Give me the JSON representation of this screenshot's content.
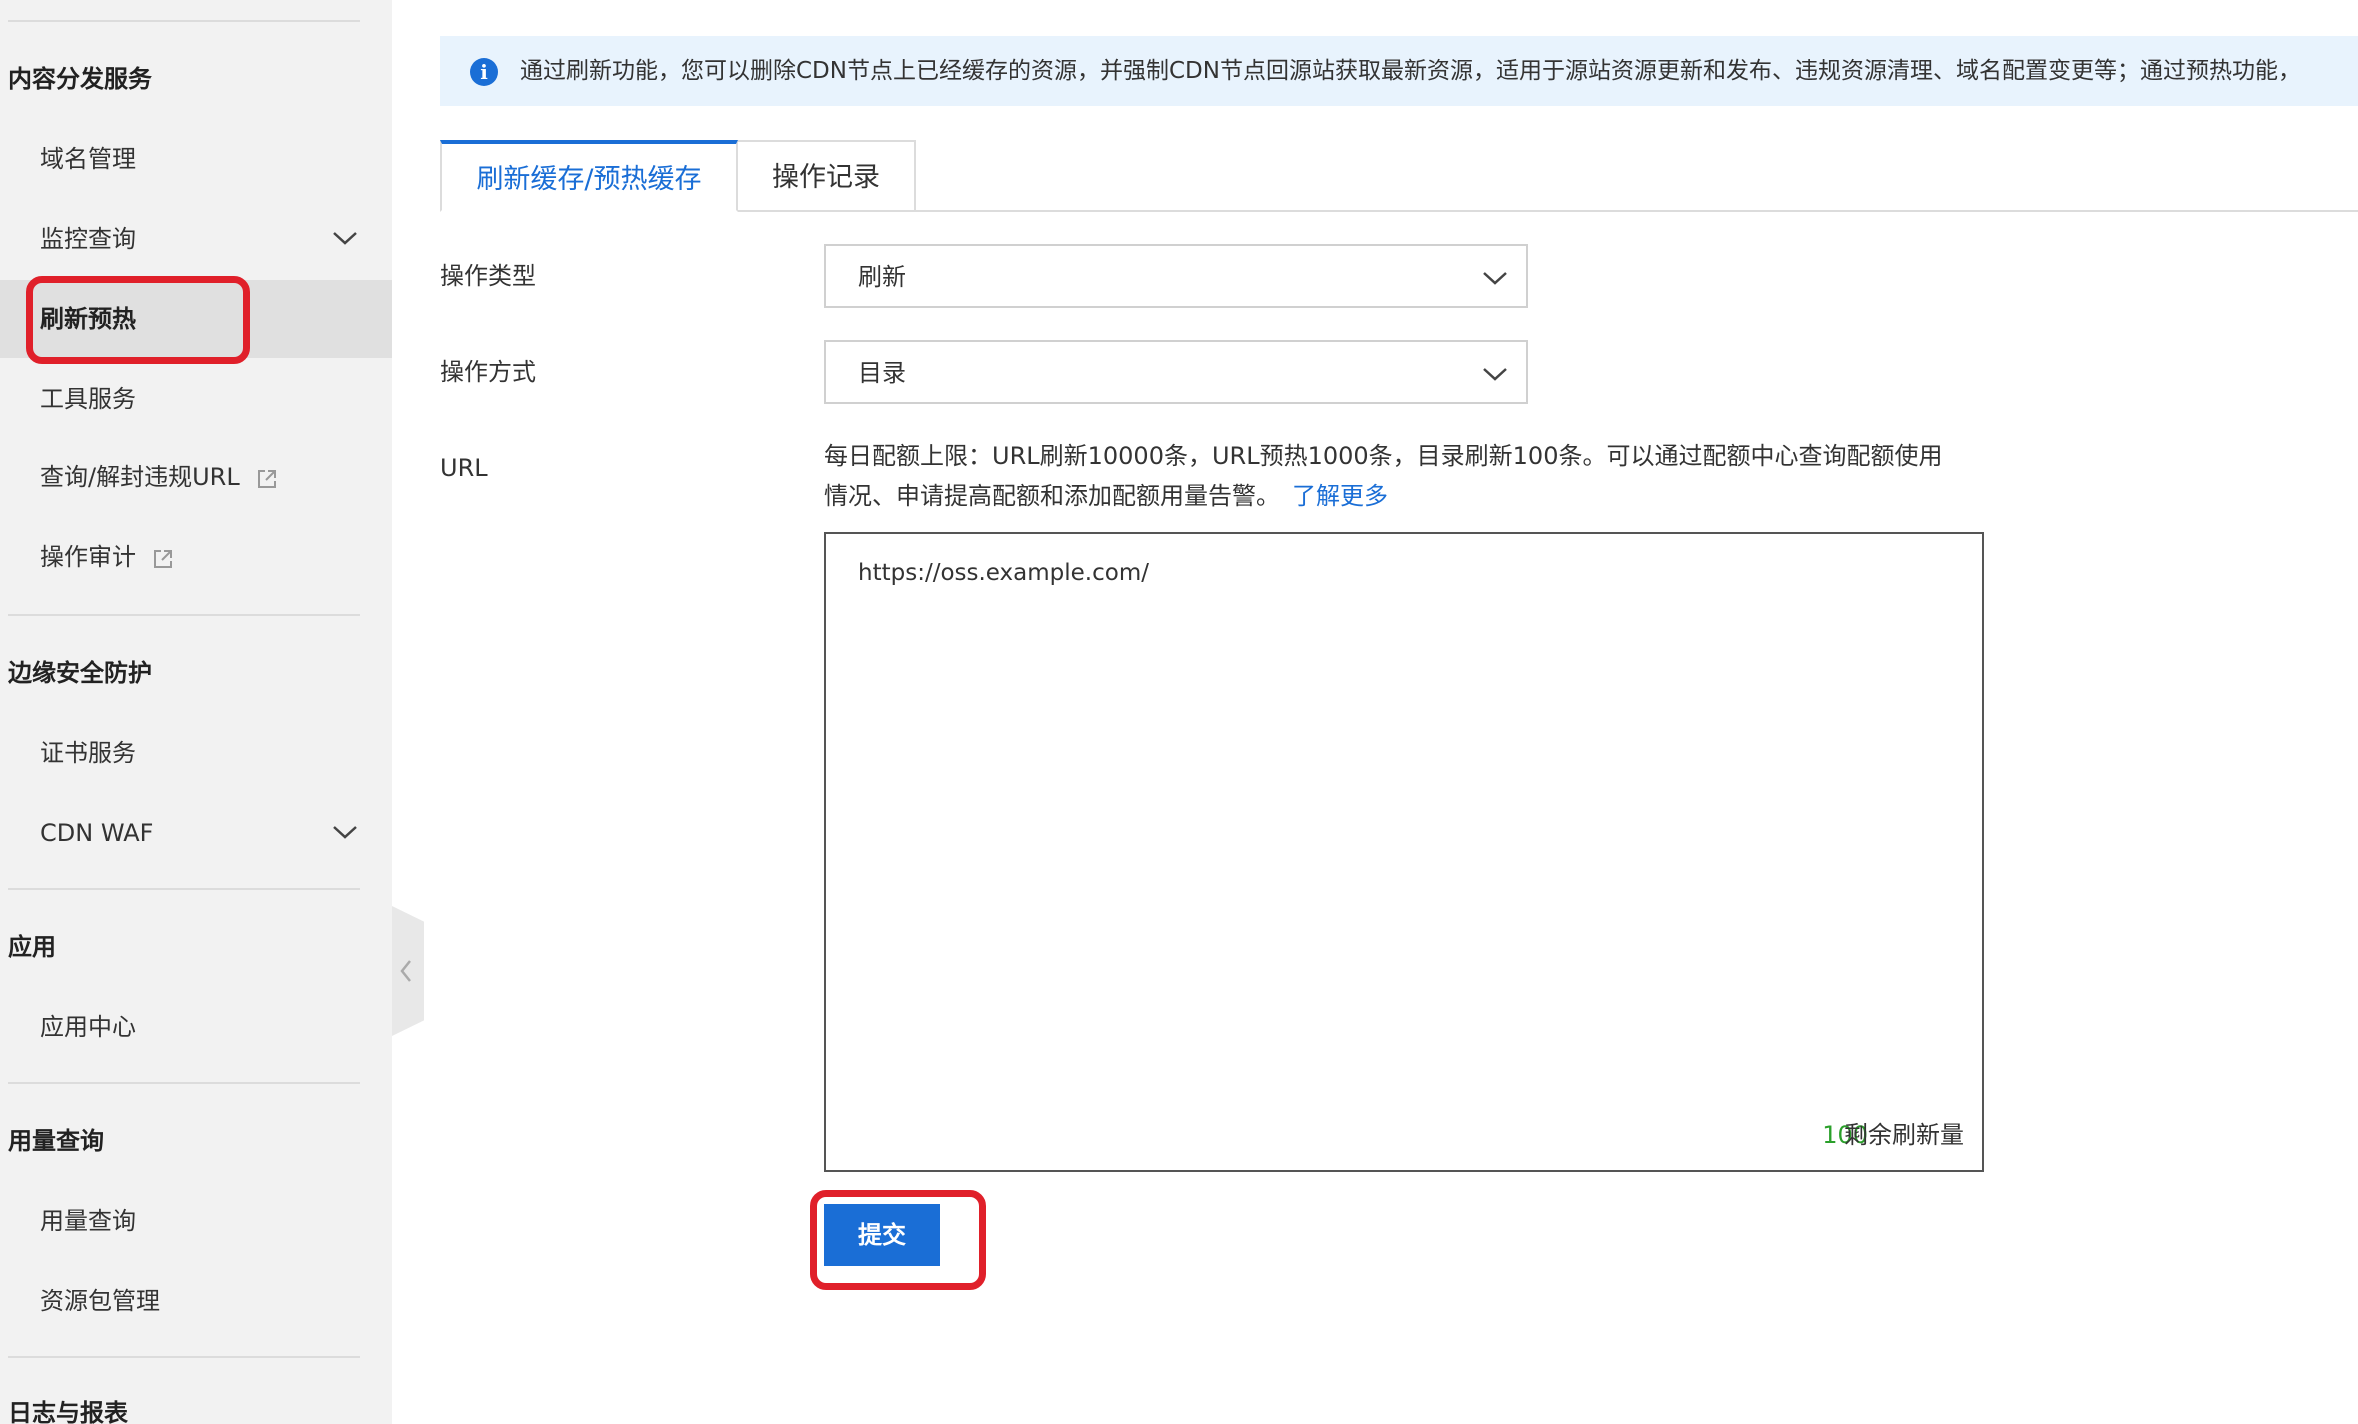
{
  "sidebar": {
    "groups": [
      {
        "title": "内容分发服务",
        "items": [
          {
            "label": "域名管理"
          },
          {
            "label": "监控查询",
            "expandable": true
          },
          {
            "label": "刷新预热",
            "active": true
          },
          {
            "label": "工具服务"
          },
          {
            "label": "查询/解封违规URL",
            "external": true
          },
          {
            "label": "操作审计",
            "external": true
          }
        ]
      },
      {
        "title": "边缘安全防护",
        "items": [
          {
            "label": "证书服务"
          },
          {
            "label": "CDN WAF",
            "expandable": true
          }
        ]
      },
      {
        "title": "应用",
        "items": [
          {
            "label": "应用中心"
          }
        ]
      },
      {
        "title": "用量查询",
        "items": [
          {
            "label": "用量查询"
          },
          {
            "label": "资源包管理"
          }
        ]
      },
      {
        "title": "日志与报表",
        "items": []
      }
    ]
  },
  "notice": {
    "icon": "info-icon",
    "text": "通过刷新功能，您可以删除CDN节点上已经缓存的资源，并强制CDN节点回源站获取最新资源，适用于源站资源更新和发布、违规资源清理、域名配置变更等；通过预热功能，"
  },
  "tabs": [
    {
      "label": "刷新缓存/预热缓存",
      "active": true
    },
    {
      "label": "操作记录"
    }
  ],
  "form": {
    "op_type": {
      "label": "操作类型",
      "value": "刷新"
    },
    "op_method": {
      "label": "操作方式",
      "value": "目录"
    },
    "url": {
      "label": "URL",
      "note": "每日配额上限：URL刷新10000条，URL预热1000条，目录刷新100条。可以通过配额中心查询配额使用情况、申请提高配额和添加配额用量告警。",
      "link": "了解更多",
      "value": "https://oss.example.com/",
      "remaining_count": "100",
      "remaining_label": "剩余刷新量"
    },
    "submit_label": "提交"
  },
  "colors": {
    "accent": "#1a6ed6",
    "highlight": "#e0202a",
    "count_green": "#2ba02b"
  }
}
